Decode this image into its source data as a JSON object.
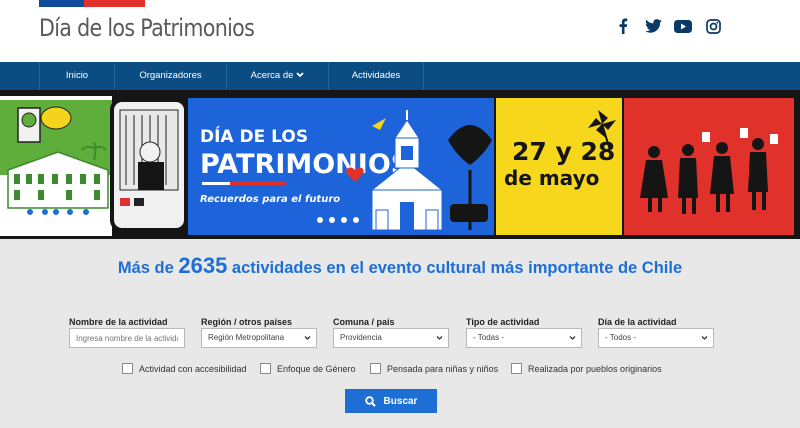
{
  "header": {
    "logo_text": "Día de los Patrimonios",
    "flag_colors": [
      "#0f4c9c",
      "#e0312b"
    ],
    "social": [
      "facebook-icon",
      "twitter-icon",
      "youtube-icon",
      "instagram-icon"
    ],
    "social_color": "#0b3a66"
  },
  "nav": {
    "items": [
      {
        "label": "Inicio"
      },
      {
        "label": "Organizadores"
      },
      {
        "label": "Acerca de"
      },
      {
        "label": "Actividades"
      }
    ],
    "bg": "#0b4d82"
  },
  "banner": {
    "title_line1": "DÍA DE LOS",
    "title_line2": "PATRIMONIOS",
    "subtitle": "Recuerdos para el futuro",
    "date_line1": "27 y 28",
    "date_line2": "de mayo"
  },
  "search": {
    "headline_pre": "Más de",
    "headline_count": "2635",
    "headline_post": "actividades en el evento cultural más importante de Chile",
    "fields": [
      {
        "label": "Nombre de la actividad",
        "placeholder": "Ingresa nombre de la actividad"
      },
      {
        "label": "Región / otros países",
        "value": "Región Metropolitana"
      },
      {
        "label": "Comuna / país",
        "value": "Providencia"
      },
      {
        "label": "Tipo de actividad",
        "value": "- Todas -"
      },
      {
        "label": "Día de la actividad",
        "value": "- Todos -"
      }
    ],
    "checkboxes": [
      {
        "label": "Actividad con accesibilidad",
        "checked": false
      },
      {
        "label": "Enfoque de Género",
        "checked": false
      },
      {
        "label": "Pensada para niñas y niños",
        "checked": false
      },
      {
        "label": "Realizada por pueblos originarios",
        "checked": false
      }
    ],
    "button_label": "Buscar",
    "accent": "#1d6fd6"
  }
}
